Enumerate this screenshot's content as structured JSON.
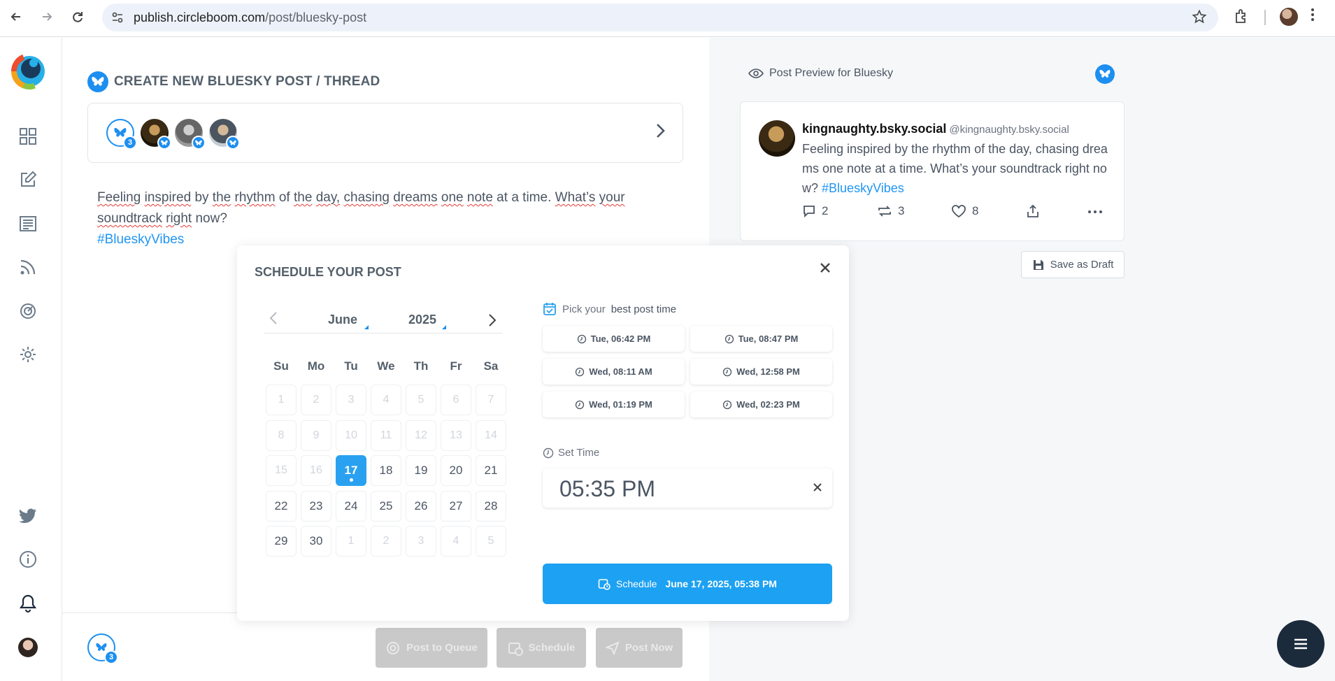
{
  "browser": {
    "url_host": "publish.circleboom.com",
    "url_path": "/post/bluesky-post"
  },
  "compose": {
    "title": "CREATE NEW BLUESKY POST / THREAD",
    "accounts_count": "3",
    "post_words": [
      "Feeling",
      "inspired",
      "by",
      "the",
      "rhythm",
      "of",
      "the",
      "day,",
      "chasing",
      "dreams",
      "one",
      "note",
      "at",
      "a",
      "time.",
      "What’s",
      "your",
      "soundtrack",
      "right",
      "now?"
    ],
    "hashtag": "#BlueskyVibes"
  },
  "bottom_bar": {
    "accounts_count": "3",
    "post_to_queue": "Post to Queue",
    "schedule": "Schedule",
    "post_now": "Post Now"
  },
  "preview": {
    "title": "Post Preview for Bluesky",
    "name": "kingnaughty.bsky.social",
    "handle": "@kingnaughty.bsky.social",
    "text": "Feeling inspired by the rhythm of the day, chasing dreams one note at a time. What’s your soundtrack right now?",
    "hashtag": "#BlueskyVibes",
    "replies": "2",
    "reposts": "3",
    "likes": "8",
    "save_draft": "Save as Draft"
  },
  "schedule_modal": {
    "title": "SCHEDULE YOUR POST",
    "month": "June",
    "year": "2025",
    "weekdays": [
      "Su",
      "Mo",
      "Tu",
      "We",
      "Th",
      "Fr",
      "Sa"
    ],
    "days": [
      {
        "d": "1",
        "s": "off"
      },
      {
        "d": "2",
        "s": "off"
      },
      {
        "d": "3",
        "s": "off"
      },
      {
        "d": "4",
        "s": "off"
      },
      {
        "d": "5",
        "s": "off"
      },
      {
        "d": "6",
        "s": "off"
      },
      {
        "d": "7",
        "s": "off"
      },
      {
        "d": "8",
        "s": "off"
      },
      {
        "d": "9",
        "s": "off"
      },
      {
        "d": "10",
        "s": "off"
      },
      {
        "d": "11",
        "s": "off"
      },
      {
        "d": "12",
        "s": "off"
      },
      {
        "d": "13",
        "s": "off"
      },
      {
        "d": "14",
        "s": "off"
      },
      {
        "d": "15",
        "s": "off"
      },
      {
        "d": "16",
        "s": "off"
      },
      {
        "d": "17",
        "s": "sel"
      },
      {
        "d": "18",
        "s": ""
      },
      {
        "d": "19",
        "s": ""
      },
      {
        "d": "20",
        "s": ""
      },
      {
        "d": "21",
        "s": ""
      },
      {
        "d": "22",
        "s": ""
      },
      {
        "d": "23",
        "s": ""
      },
      {
        "d": "24",
        "s": ""
      },
      {
        "d": "25",
        "s": ""
      },
      {
        "d": "26",
        "s": ""
      },
      {
        "d": "27",
        "s": ""
      },
      {
        "d": "28",
        "s": ""
      },
      {
        "d": "29",
        "s": ""
      },
      {
        "d": "30",
        "s": ""
      },
      {
        "d": "1",
        "s": "off"
      },
      {
        "d": "2",
        "s": "off"
      },
      {
        "d": "3",
        "s": "off"
      },
      {
        "d": "4",
        "s": "off"
      },
      {
        "d": "5",
        "s": "off"
      }
    ],
    "best_time_prefix": "Pick your",
    "best_time_label": "best post time",
    "best_times": [
      "Tue, 06:42 PM",
      "Tue, 08:47 PM",
      "Wed, 08:11 AM",
      "Wed, 12:58 PM",
      "Wed, 01:19 PM",
      "Wed, 02:23 PM"
    ],
    "set_time_label": "Set Time",
    "time_value": "05:35 PM",
    "schedule_label": "Schedule",
    "schedule_datetime": "June 17, 2025, 05:38 PM"
  },
  "colors": {
    "accent": "#1da1f2",
    "bluesky": "#1d8ff0",
    "selected_day": "#2aa1f0",
    "fab": "#1b2b3c"
  }
}
